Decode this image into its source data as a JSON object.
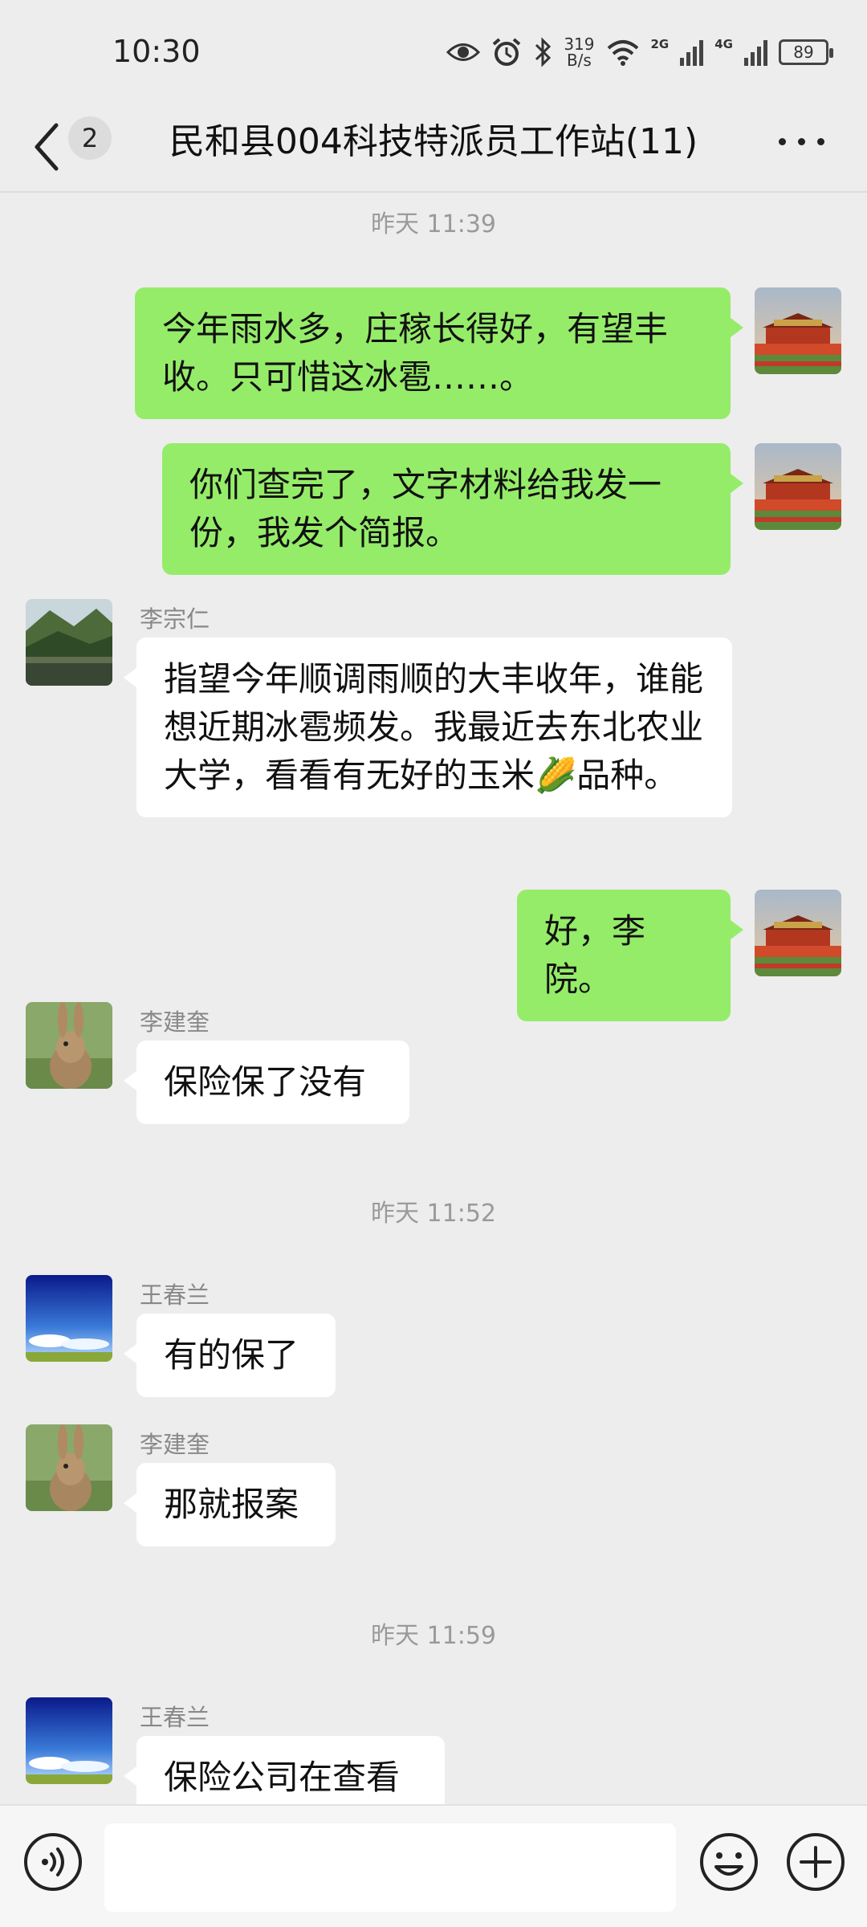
{
  "status_bar": {
    "time": "10:30",
    "net_speed_value": "319",
    "net_speed_unit": "B/s",
    "signal_1": "2G",
    "signal_2": "4G",
    "battery": "89",
    "icons": [
      "eye-icon",
      "alarm-icon",
      "bluetooth-icon",
      "wifi-icon",
      "cell-signal-icon",
      "battery-icon"
    ]
  },
  "header": {
    "back_count": "2",
    "title": "民和县004科技特派员工作站(11)",
    "icons": [
      "back-chevron-icon",
      "more-dots-icon"
    ]
  },
  "messages": [
    {
      "type": "timestamp",
      "text": "昨天 11:39"
    },
    {
      "type": "me",
      "text": "今年雨水多，庄稼长得好，有望丰收。只可惜这冰雹……。",
      "avatar": "gate-avatar"
    },
    {
      "type": "me",
      "text": "你们查完了，文字材料给我发一份，我发个简报。",
      "avatar": "gate-avatar"
    },
    {
      "type": "other",
      "sender": "李宗仁",
      "text": "指望今年顺调雨顺的大丰收年，谁能想近期冰雹频发。我最近去东北农业大学，看看有无好的玉米🌽品种。",
      "avatar": "mountain-lake-avatar"
    },
    {
      "type": "me",
      "text": "好，李院。",
      "avatar": "gate-avatar"
    },
    {
      "type": "other",
      "sender": "李建奎",
      "text": "保险保了没有",
      "avatar": "rabbit-avatar"
    },
    {
      "type": "timestamp",
      "text": "昨天 11:52"
    },
    {
      "type": "other",
      "sender": "王春兰",
      "text": "有的保了",
      "avatar": "blue-sky-avatar"
    },
    {
      "type": "other",
      "sender": "李建奎",
      "text": "那就报案",
      "avatar": "rabbit-avatar"
    },
    {
      "type": "timestamp",
      "text": "昨天 11:59"
    },
    {
      "type": "other",
      "sender": "王春兰",
      "text": "保险公司在查看",
      "avatar": "blue-sky-avatar"
    }
  ],
  "bottom_bar": {
    "input_value": "",
    "icons": [
      "voice-icon",
      "emoji-icon",
      "plus-icon"
    ]
  }
}
